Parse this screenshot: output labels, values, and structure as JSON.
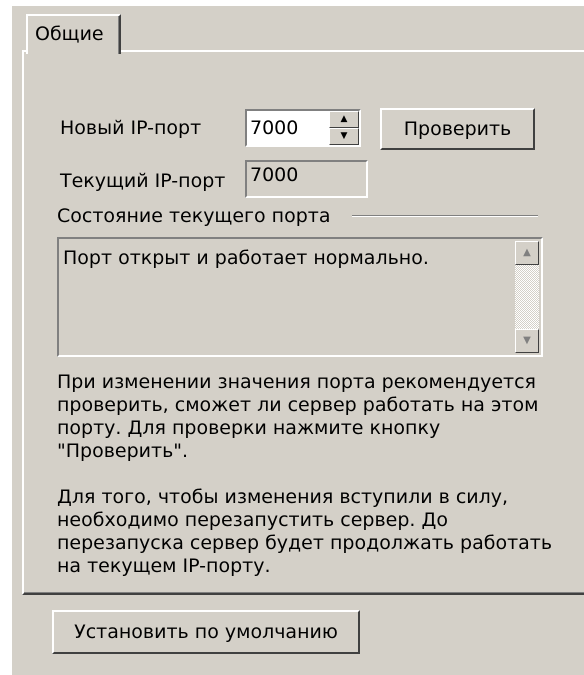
{
  "tabs": [
    {
      "label": "Общие",
      "selected": true
    }
  ],
  "new_port": {
    "label": "Новый IP-порт",
    "value": "7000"
  },
  "check_button": {
    "label": "Проверить"
  },
  "current_port": {
    "label": "Текущий IP-порт",
    "value": "7000"
  },
  "status_group": {
    "title": "Состояние текущего порта",
    "text": "Порт открыт и работает нормально."
  },
  "help_paragraphs": [
    "При изменении значения порта рекомендуется проверить, сможет ли сервер работать на этом порту. Для проверки нажмите кнопку \"Проверить\".",
    "Для того, чтобы изменения вступили в силу, необходимо перезапустить сервер. До перезапуска сервер будет продолжать работать на текущем IP-порту."
  ],
  "defaults_button": {
    "label": "Установить по умолчанию"
  },
  "colors": {
    "face": "#d4d0c8",
    "highlight": "#ffffff",
    "shadow": "#808080",
    "dark_shadow": "#404040"
  }
}
